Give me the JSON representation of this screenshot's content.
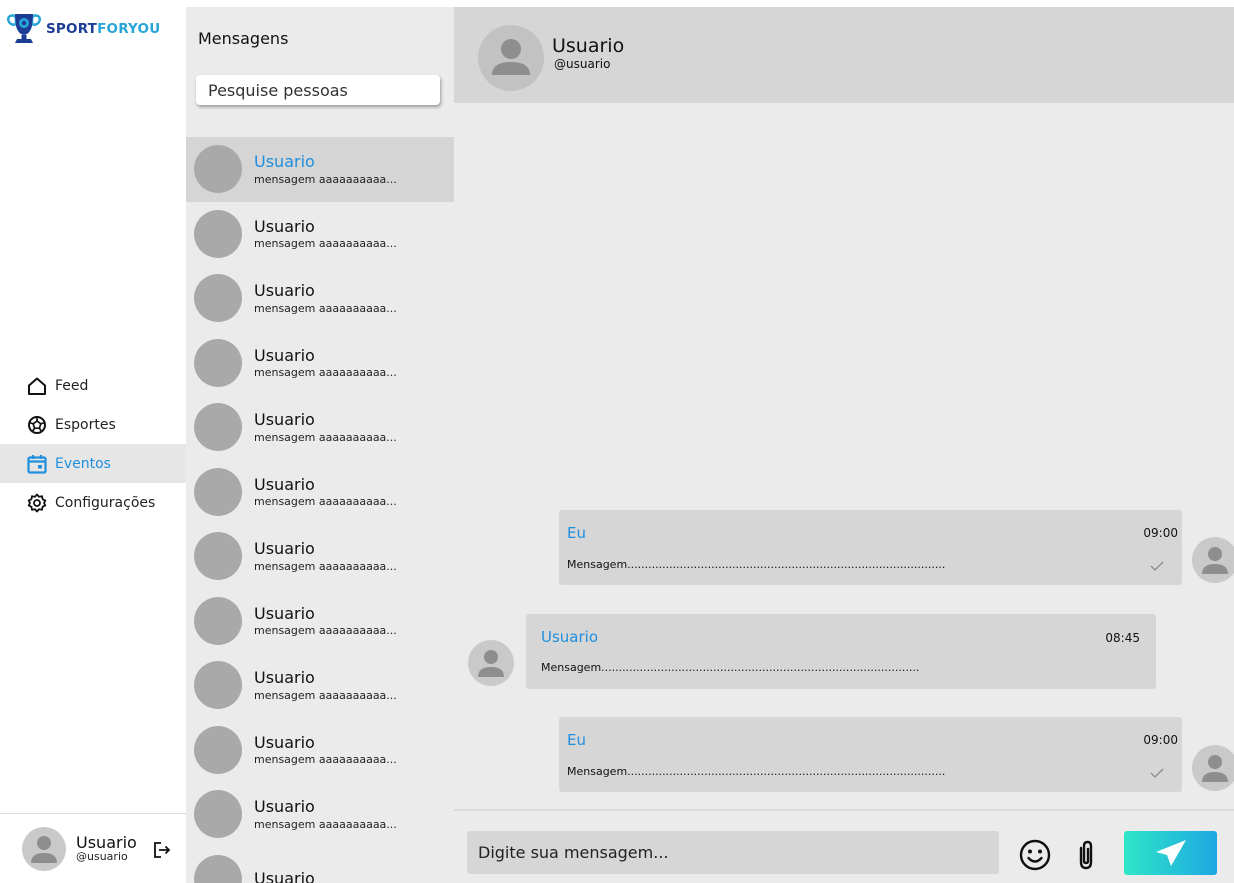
{
  "brand": {
    "part1": "SPORT",
    "part2": "FORYOU",
    "color1": "#1b3d95",
    "color2": "#28a6d9"
  },
  "nav": {
    "items": [
      {
        "label": "Feed",
        "icon": "home-icon"
      },
      {
        "label": "Esportes",
        "icon": "ball-icon"
      },
      {
        "label": "Eventos",
        "icon": "calendar-icon",
        "active": true
      },
      {
        "label": "Configurações",
        "icon": "gear-icon"
      }
    ],
    "accent": "#1f8fde"
  },
  "current_user": {
    "name": "Usuario",
    "handle": "@usuario"
  },
  "conversations": {
    "title": "Mensagens",
    "search_placeholder": "Pesquise pessoas",
    "items": [
      {
        "name": "Usuario",
        "preview": "mensagem aaaaaaaaaa..."
      },
      {
        "name": "Usuario",
        "preview": "mensagem aaaaaaaaaa..."
      },
      {
        "name": "Usuario",
        "preview": "mensagem aaaaaaaaaa..."
      },
      {
        "name": "Usuario",
        "preview": "mensagem aaaaaaaaaa..."
      },
      {
        "name": "Usuario",
        "preview": "mensagem aaaaaaaaaa..."
      },
      {
        "name": "Usuario",
        "preview": "mensagem aaaaaaaaaa..."
      },
      {
        "name": "Usuario",
        "preview": "mensagem aaaaaaaaaa..."
      },
      {
        "name": "Usuario",
        "preview": "mensagem aaaaaaaaaa..."
      },
      {
        "name": "Usuario",
        "preview": "mensagem aaaaaaaaaa..."
      },
      {
        "name": "Usuario",
        "preview": "mensagem aaaaaaaaaa..."
      },
      {
        "name": "Usuario",
        "preview": "mensagem aaaaaaaaaa..."
      },
      {
        "name": "Usuario",
        "preview": ""
      }
    ]
  },
  "chat": {
    "contact": {
      "name": "Usuario",
      "handle": "@usuario"
    },
    "messages": [
      {
        "sender": "Eu",
        "time": "09:00",
        "text": "Mensagem..........................................................................................."
      },
      {
        "sender": "Usuario",
        "time": "08:45",
        "text": "Mensagem..........................................................................................."
      },
      {
        "sender": "Eu",
        "time": "09:00",
        "text": "Mensagem..........................................................................................."
      }
    ],
    "input_placeholder": "Digite sua mensagem..."
  }
}
